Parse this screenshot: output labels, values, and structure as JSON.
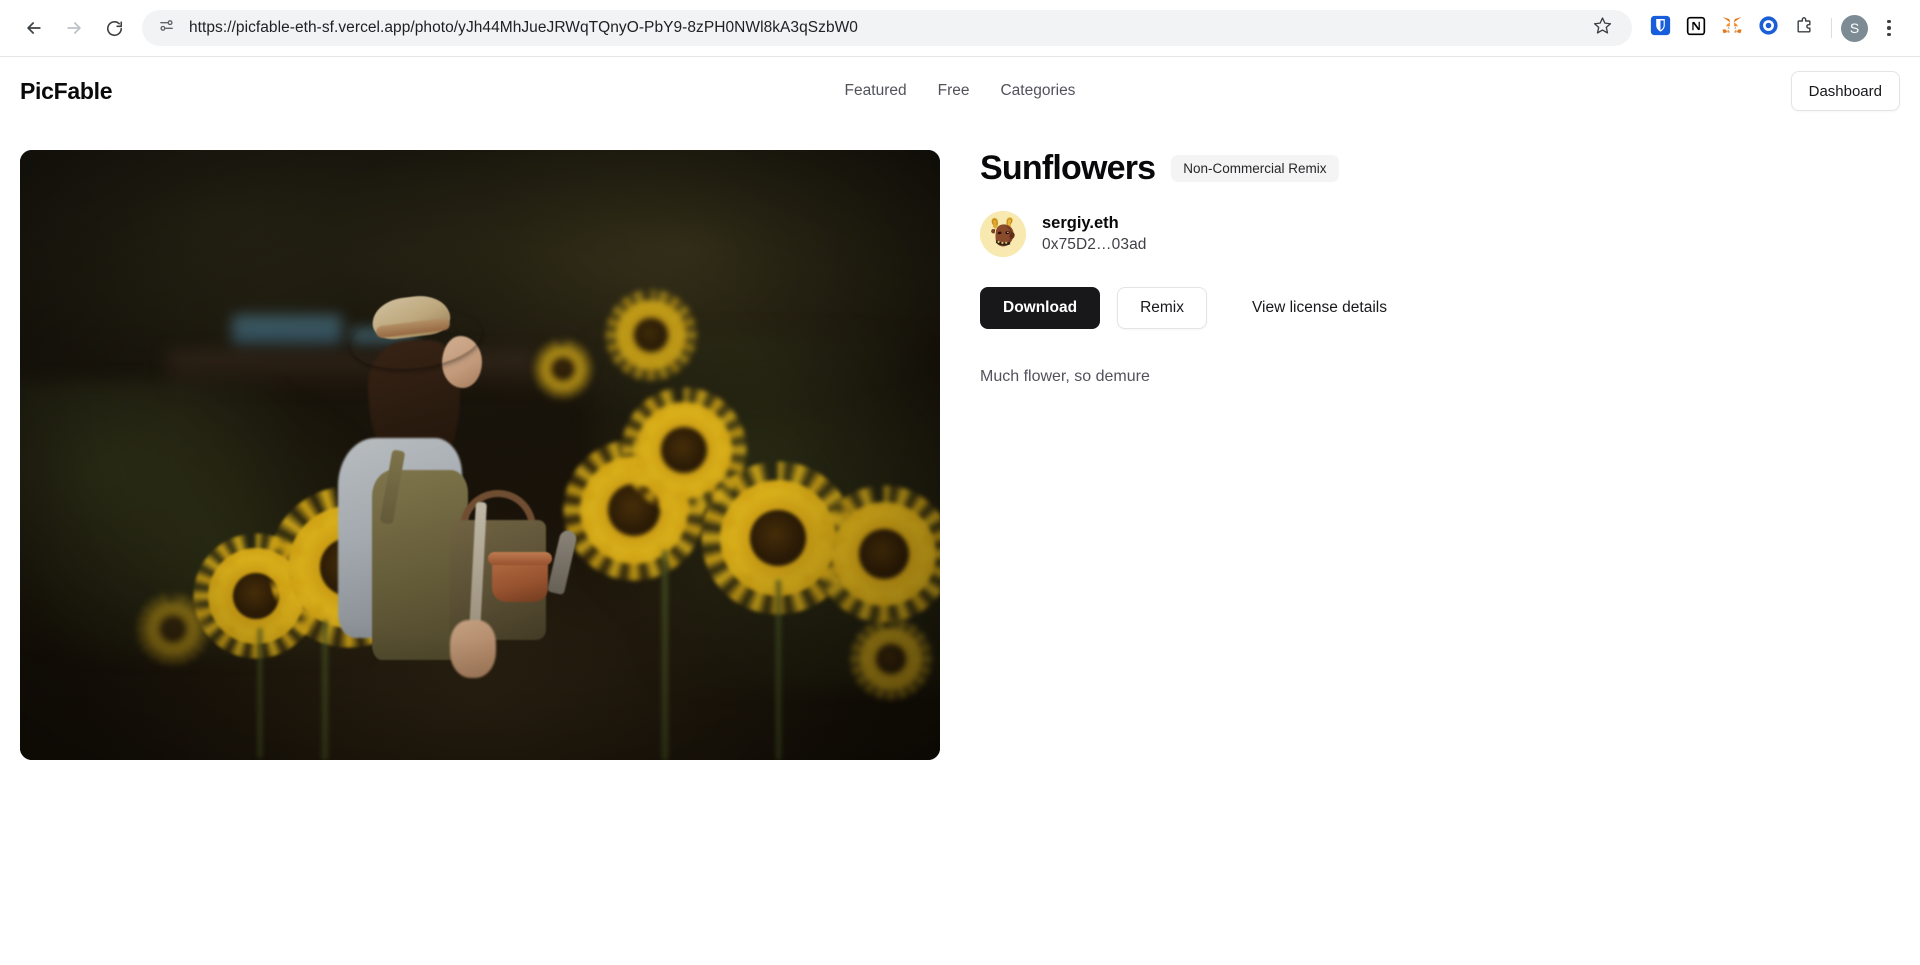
{
  "browser": {
    "url": "https://picfable-eth-sf.vercel.app/photo/yJh44MhJueJRWqTQnyO-PbY9-8zPH0NWl8kA3qSzbW0",
    "back_icon": "back-arrow-icon",
    "forward_icon": "forward-arrow-icon",
    "reload_icon": "reload-icon",
    "site_controls_icon": "site-settings-icon",
    "bookmark_icon": "star-icon",
    "profile_initial": "S",
    "extensions": [
      {
        "name": "bitwarden-extension-icon",
        "color": "#175DDC"
      },
      {
        "name": "notion-extension-icon",
        "color": "#000000"
      },
      {
        "name": "metamask-extension-icon",
        "color": "#E2761B"
      },
      {
        "name": "opera-wallet-extension-icon",
        "color": "#1A5FD6"
      },
      {
        "name": "extensions-puzzle-icon",
        "color": "#5F6368"
      }
    ],
    "menu_icon": "kebab-menu-icon"
  },
  "header": {
    "brand": "PicFable",
    "nav": [
      {
        "label": "Featured",
        "name": "nav-link-featured"
      },
      {
        "label": "Free",
        "name": "nav-link-free"
      },
      {
        "label": "Categories",
        "name": "nav-link-categories"
      }
    ],
    "dashboard_label": "Dashboard"
  },
  "photo": {
    "alt": "Woman in straw hat walking through a sunflower garden at dusk",
    "scene": "sunflower-garden-portrait"
  },
  "details": {
    "title": "Sunflowers",
    "license_badge": "Non-Commercial Remix",
    "author": {
      "name": "sergiy.eth",
      "address": "0x75D2…03ad",
      "avatar_icon": "goat-avatar-icon"
    },
    "actions": {
      "download_label": "Download",
      "remix_label": "Remix",
      "license_link_label": "View license details"
    },
    "description": "Much flower, so demure"
  },
  "colors": {
    "accent_dark": "#18181b",
    "badge_bg": "#f4f4f5",
    "muted_text": "#52525b",
    "border": "#e4e4e7"
  }
}
